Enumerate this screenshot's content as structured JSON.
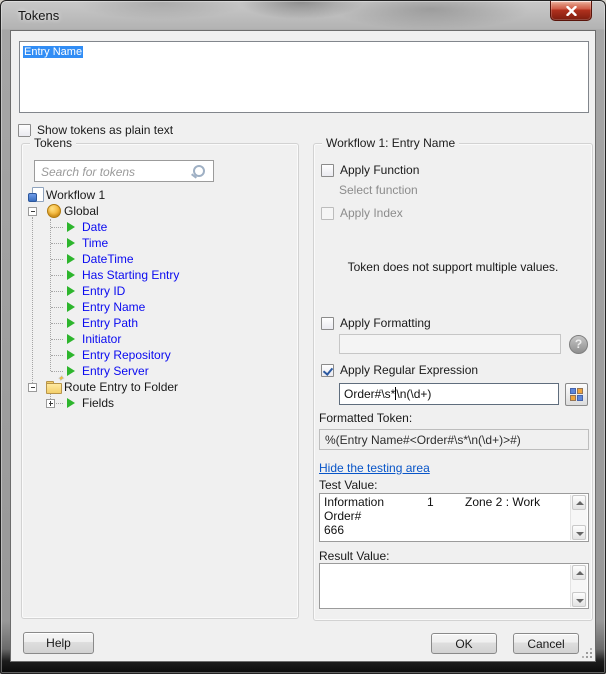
{
  "window": {
    "title": "Tokens"
  },
  "colors": {
    "selection_bg": "#318df5",
    "tree_token_blue": "#0a0af0",
    "token_arrow_green": "#2db52d",
    "link_blue": "#0855c8",
    "close_button_red": "#b2321e",
    "regex_icon_blue": "#5e86d8",
    "regex_icon_orange": "#f0a53a"
  },
  "editor": {
    "selected_text": "Entry Name"
  },
  "show_plain": {
    "label": "Show tokens as plain text",
    "checked": false
  },
  "tokens_panel": {
    "title": "Tokens",
    "search_placeholder": "Search for tokens",
    "tree": [
      {
        "label": "Workflow 1",
        "icon": "workflow",
        "level": 0,
        "expander": "",
        "style": "black"
      },
      {
        "label": "Global",
        "icon": "coin",
        "level": 1,
        "expander": "minus",
        "style": "black"
      },
      {
        "label": "Date",
        "icon": "token",
        "level": 2,
        "expander": "",
        "style": "blue"
      },
      {
        "label": "Time",
        "icon": "token",
        "level": 2,
        "expander": "",
        "style": "blue"
      },
      {
        "label": "DateTime",
        "icon": "token",
        "level": 2,
        "expander": "",
        "style": "blue"
      },
      {
        "label": "Has Starting Entry",
        "icon": "token",
        "level": 2,
        "expander": "",
        "style": "blue"
      },
      {
        "label": "Entry ID",
        "icon": "token",
        "level": 2,
        "expander": "",
        "style": "blue"
      },
      {
        "label": "Entry Name",
        "icon": "token",
        "level": 2,
        "expander": "",
        "style": "blue"
      },
      {
        "label": "Entry Path",
        "icon": "token",
        "level": 2,
        "expander": "",
        "style": "blue"
      },
      {
        "label": "Initiator",
        "icon": "token",
        "level": 2,
        "expander": "",
        "style": "blue"
      },
      {
        "label": "Entry Repository",
        "icon": "token",
        "level": 2,
        "expander": "",
        "style": "blue"
      },
      {
        "label": "Entry Server",
        "icon": "token",
        "level": 2,
        "expander": "",
        "style": "blue"
      },
      {
        "label": "Route Entry to Folder",
        "icon": "folder",
        "level": 1,
        "expander": "minus",
        "style": "black"
      },
      {
        "label": "Fields",
        "icon": "token",
        "level": 2,
        "expander": "plus",
        "style": "black"
      }
    ]
  },
  "properties_panel": {
    "title": "Workflow 1: Entry Name",
    "apply_function_label": "Apply Function",
    "apply_function_checked": false,
    "select_function_label": "Select function",
    "apply_index_label": "Apply Index",
    "apply_index_checked": false,
    "multivalue_note": "Token does not support multiple values.",
    "apply_formatting_label": "Apply Formatting",
    "apply_formatting_checked": false,
    "formatting_value": "",
    "apply_regex_label": "Apply Regular Expression",
    "apply_regex_checked": true,
    "regex_value": "Order#\\s*\\n(\\d+)",
    "regex_caret_index": 9,
    "formatted_token_label": "Formatted Token:",
    "formatted_token_value": "%(Entry Name#<Order#\\s*\\n(\\d+)>#)",
    "testing_area_link": "Hide the testing area",
    "test_value_label": "Test Value:",
    "test_value": {
      "row1": [
        "Information",
        "1",
        "Zone 2 : Work"
      ],
      "row2": "Order#",
      "row3": "666"
    },
    "result_value_label": "Result Value:",
    "result_value": ""
  },
  "buttons": {
    "help": "Help",
    "ok": "OK",
    "cancel": "Cancel"
  }
}
